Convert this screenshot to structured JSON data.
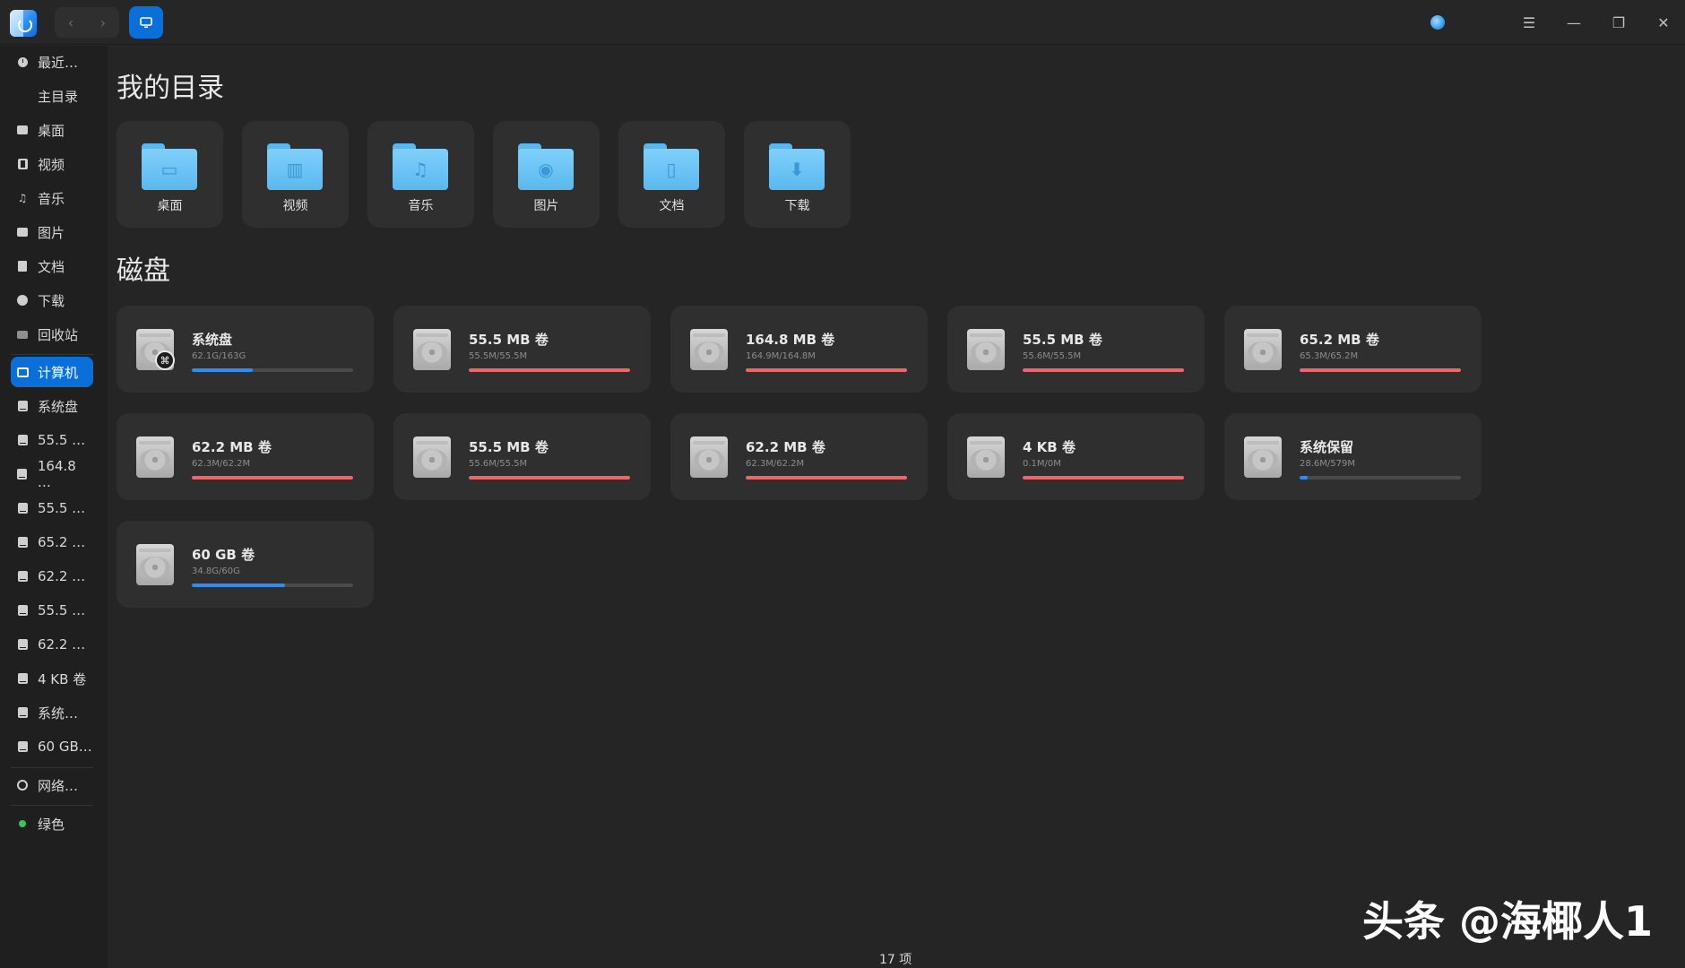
{
  "window": {
    "status_text": "17 项",
    "watermark": "头条 @海椰人1"
  },
  "titlebar": {
    "back_icon": "‹",
    "forward_icon": "›",
    "menu_icon": "☰",
    "minimize_icon": "—",
    "maximize_icon": "❐",
    "close_icon": "✕"
  },
  "sidebar": {
    "items": [
      {
        "label": "最近…",
        "icon": "clock-icon"
      },
      {
        "label": "主目录",
        "icon": "home-icon"
      },
      {
        "label": "桌面",
        "icon": "desktop-icon"
      },
      {
        "label": "视频",
        "icon": "video-icon"
      },
      {
        "label": "音乐",
        "icon": "music-icon"
      },
      {
        "label": "图片",
        "icon": "picture-icon"
      },
      {
        "label": "文档",
        "icon": "document-icon"
      },
      {
        "label": "下载",
        "icon": "download-icon"
      },
      {
        "label": "回收站",
        "icon": "trash-icon"
      },
      {
        "label": "计算机",
        "icon": "computer-icon",
        "active": true
      },
      {
        "label": "系统盘",
        "icon": "system-disk-icon"
      },
      {
        "label": "55.5 …",
        "icon": "drive-icon"
      },
      {
        "label": "164.8 …",
        "icon": "drive-icon"
      },
      {
        "label": "55.5 …",
        "icon": "drive-icon"
      },
      {
        "label": "65.2 …",
        "icon": "drive-icon"
      },
      {
        "label": "62.2 …",
        "icon": "drive-icon"
      },
      {
        "label": "55.5 …",
        "icon": "drive-icon"
      },
      {
        "label": "62.2 …",
        "icon": "drive-icon"
      },
      {
        "label": "4 KB 卷",
        "icon": "drive-icon"
      },
      {
        "label": "系统…",
        "icon": "drive-icon"
      },
      {
        "label": "60 GB…",
        "icon": "drive-icon"
      },
      {
        "label": "网络…",
        "icon": "network-icon"
      },
      {
        "label": "绿色",
        "icon": "green-tag-icon"
      }
    ]
  },
  "main": {
    "dirs_title": "我的目录",
    "disks_title": "磁盘",
    "dirs": [
      {
        "label": "桌面",
        "glyph": "▭"
      },
      {
        "label": "视频",
        "glyph": "▥"
      },
      {
        "label": "音乐",
        "glyph": "♫"
      },
      {
        "label": "图片",
        "glyph": "◉"
      },
      {
        "label": "文档",
        "glyph": "▯"
      },
      {
        "label": "下载",
        "glyph": "⬇"
      }
    ],
    "disks": [
      {
        "name": "系统盘",
        "usage": "62.1G/163G",
        "fill_fraction": 0.38,
        "color": "#2f8cf0",
        "system": true
      },
      {
        "name": "55.5 MB 卷",
        "usage": "55.5M/55.5M",
        "fill_fraction": 1.0,
        "color": "#f0646c"
      },
      {
        "name": "164.8 MB 卷",
        "usage": "164.9M/164.8M",
        "fill_fraction": 1.0,
        "color": "#f0646c"
      },
      {
        "name": "55.5 MB 卷",
        "usage": "55.6M/55.5M",
        "fill_fraction": 1.0,
        "color": "#f0646c"
      },
      {
        "name": "65.2 MB 卷",
        "usage": "65.3M/65.2M",
        "fill_fraction": 1.0,
        "color": "#f0646c"
      },
      {
        "name": "62.2 MB 卷",
        "usage": "62.3M/62.2M",
        "fill_fraction": 1.0,
        "color": "#f0646c"
      },
      {
        "name": "55.5 MB 卷",
        "usage": "55.6M/55.5M",
        "fill_fraction": 1.0,
        "color": "#f0646c"
      },
      {
        "name": "62.2 MB 卷",
        "usage": "62.3M/62.2M",
        "fill_fraction": 1.0,
        "color": "#f0646c"
      },
      {
        "name": "4 KB 卷",
        "usage": "0.1M/0M",
        "fill_fraction": 1.0,
        "color": "#f0646c"
      },
      {
        "name": "系统保留",
        "usage": "28.6M/579M",
        "fill_fraction": 0.05,
        "color": "#2f8cf0"
      },
      {
        "name": "60 GB 卷",
        "usage": "34.8G/60G",
        "fill_fraction": 0.58,
        "color": "#2f8cf0"
      }
    ]
  }
}
